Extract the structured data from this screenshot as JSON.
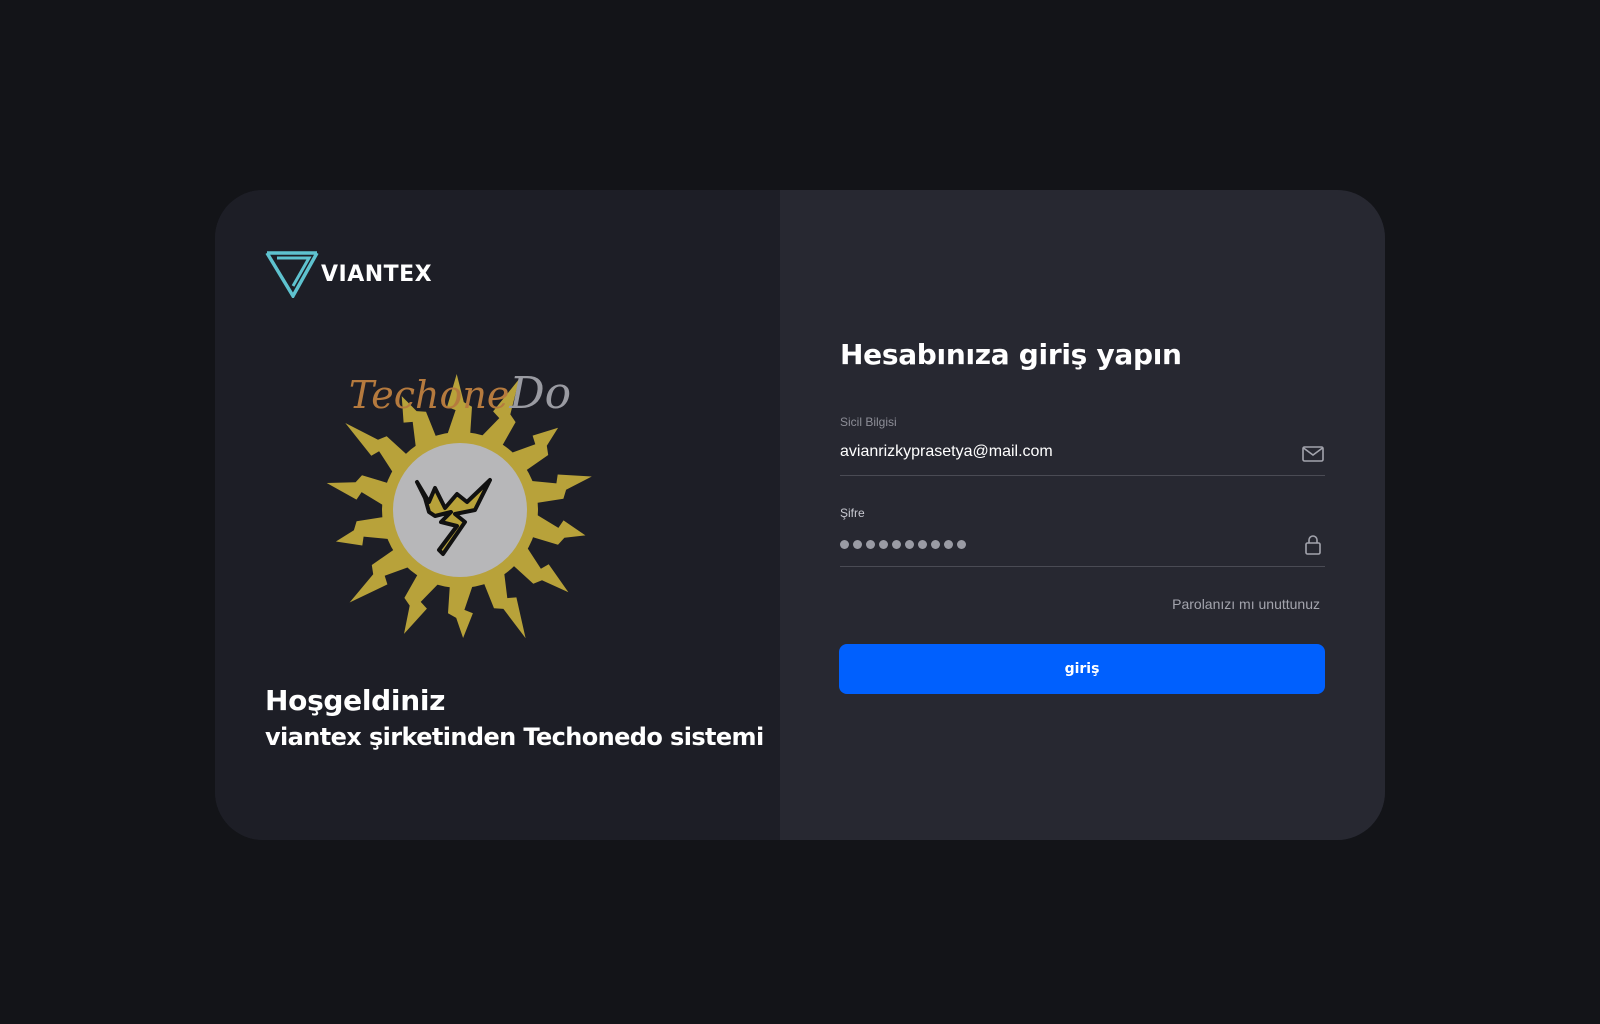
{
  "brand": {
    "name": "VIANTEX",
    "logo_icon": "viantex-triangle-icon",
    "accent": "#5ec2cf"
  },
  "emblem": {
    "icon": "techonedo-sun-emblem",
    "wordmark": "TechoneDo",
    "colors": {
      "sun": "#b8a23a",
      "disc": "#b7b7b9",
      "script": "#b57a3e",
      "script_alt": "#9a9ba2"
    }
  },
  "welcome": {
    "title": "Hoşgeldiniz",
    "subtitle": "viantex şirketinden Techonedo sistemi"
  },
  "login": {
    "title": "Hesabınıza giriş yapın",
    "email": {
      "label": "Sicil Bilgisi",
      "value": "avianrizkyprasetya@mail.com",
      "icon": "mail-icon"
    },
    "password": {
      "label": "Şifre",
      "masked_length": 10,
      "icon": "lock-icon"
    },
    "forgot_link": "Parolanızı mı unuttunuz",
    "submit_label": "giriş",
    "submit_color": "#0060fe"
  }
}
